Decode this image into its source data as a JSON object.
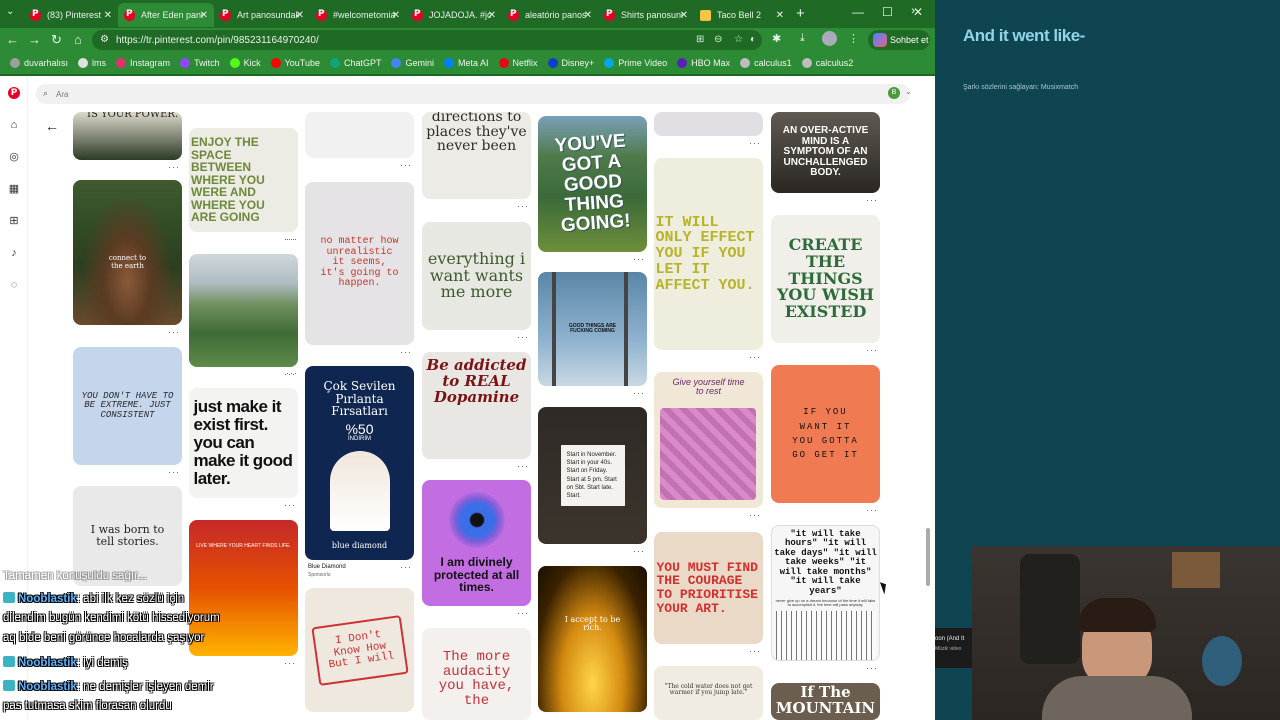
{
  "tabs": [
    {
      "label": "(83) Pinterest",
      "active": false
    },
    {
      "label": "After Eden pano",
      "active": true
    },
    {
      "label": "Art panosundaki",
      "active": false
    },
    {
      "label": "#welcometomia",
      "active": false
    },
    {
      "label": "JOJADOJA. #joj",
      "active": false
    },
    {
      "label": "aleatório panos",
      "active": false
    },
    {
      "label": "Shirts panosund",
      "active": false
    },
    {
      "label": "Taco Bell 2",
      "active": false
    }
  ],
  "url": "https://tr.pinterest.com/pin/985231164970240/",
  "sohbet_label": "Sohbet et",
  "bookmarks": [
    "duvarhalısı",
    "lms",
    "Instagram",
    "Twitch",
    "Kick",
    "YouTube",
    "ChatGPT",
    "Gemini",
    "Meta AI",
    "Netflix",
    "Disney+",
    "Prime Video",
    "HBO Max",
    "calculus1",
    "calculus2"
  ],
  "bookmark_colors": [
    "#9e9e9e",
    "#e0e0e0",
    "#e1306c",
    "#9146ff",
    "#53fc18",
    "#ff0000",
    "#10a37f",
    "#4285f4",
    "#0081fb",
    "#e50914",
    "#113ccf",
    "#00a8e1",
    "#5822b4",
    "#bdbdbd",
    "#bdbdbd"
  ],
  "search_placeholder": "Ara",
  "avatar_initial": "B",
  "pins": {
    "c1_power": "IS YOUR POWER.",
    "c1_connect": "connect to the earth",
    "c1_extreme": "YOU DON'T HAVE TO BE EXTREME. JUST CONSISTENT",
    "c1_born": "I was born to tell stories.",
    "c2_space": "ENJOY THE SPACE BETWEEN WHERE YOU WERE AND WHERE YOU ARE GOING",
    "c2_justmake": "just make it exist first. you can make it good later.",
    "c2_live": "LIVE WHERE YOUR HEART FINDS LIFE.",
    "c3_nomatter": "no matter how unrealistic it seems, it's going to happen.",
    "c3_cok": "Çok Sevilen Pırlanta Fırsatları",
    "c3_percent": "%50",
    "c3_indirim": "İNDİRİM",
    "c3_brand_logo": "blue diamond",
    "c3_brand": "Blue Diamond",
    "c3_sponsored": "Sponsorlu",
    "c3_dontknow": "I Don't Know How But I will",
    "c4_directions": "directions to places they've never been",
    "c4_everything": "everything i want wants me more",
    "c4_addicted": "Be addicted to REAL Dopamine",
    "c4_divinely": "I am divinely protected at all times.",
    "c4_audacity": "The more audacity you have, the",
    "c5_good": "YOU'VE GOT A GOOD THING GOING!",
    "c5_sign": "GOOD THINGS ARE FUCKING COMING",
    "c5_start": "Start in November. Start in your 40s. Start on Friday. Start at 5 pm. Start on Sbt. Start late. Start.",
    "c5_rich": "I accept to be rich.",
    "c6_effect": "IT WILL ONLY EFFECT YOU IF YOU LET IT AFFECT YOU.",
    "c6_rest": "Give yourself time to rest",
    "c6_courage": "YOU MUST FIND THE COURAGE TO PRIORITISE YOUR ART.",
    "c6_cold": "\"The cold water does not get warmer if you jump late.\"",
    "c7_overactive": "AN OVER-ACTIVE MIND IS A SYMPTOM OF AN UNCHALLENGED BODY.",
    "c7_create": "CREATE THE THINGS YOU WISH EXISTED",
    "c7_want": "IF YOU WANT IT YOU GOTTA GO GET IT",
    "c7_takes": "\"it will take hours\" \"it will take days\" \"it will take weeks\" \"it will take months\" \"it will take years\"",
    "c7_takes_sub": "never give up on a dream because of the time it will take to accomplish it. the time will pass anyway.",
    "c7_mountain": "If The MOUNTAIN"
  },
  "lyrics": {
    "line": "And it went like-",
    "credit": "Şarkı sözlerini sağlayan: Musixmatch"
  },
  "spotify": {
    "title": "oon (And It",
    "subtitle": "Müzik video"
  },
  "chat": [
    {
      "name": "",
      "text": "Tamamen konuşuldu sağır...",
      "faded": true
    },
    {
      "name": "Nooblastik",
      "text": ": abi ilk kez sözlü için"
    },
    {
      "name": "",
      "text": "dilendim bugün kendimi kötü hissediyorum"
    },
    {
      "name": "",
      "text": "aq bide beni görünce hocalarda şaşıyor"
    },
    {
      "name": "Nooblastik",
      "text": ": iyi demiş"
    },
    {
      "name": "Nooblastik",
      "text": ": ne demişler işleyen demir"
    },
    {
      "name": "",
      "text": "pas tutmasa skim florasan olurdu"
    }
  ]
}
